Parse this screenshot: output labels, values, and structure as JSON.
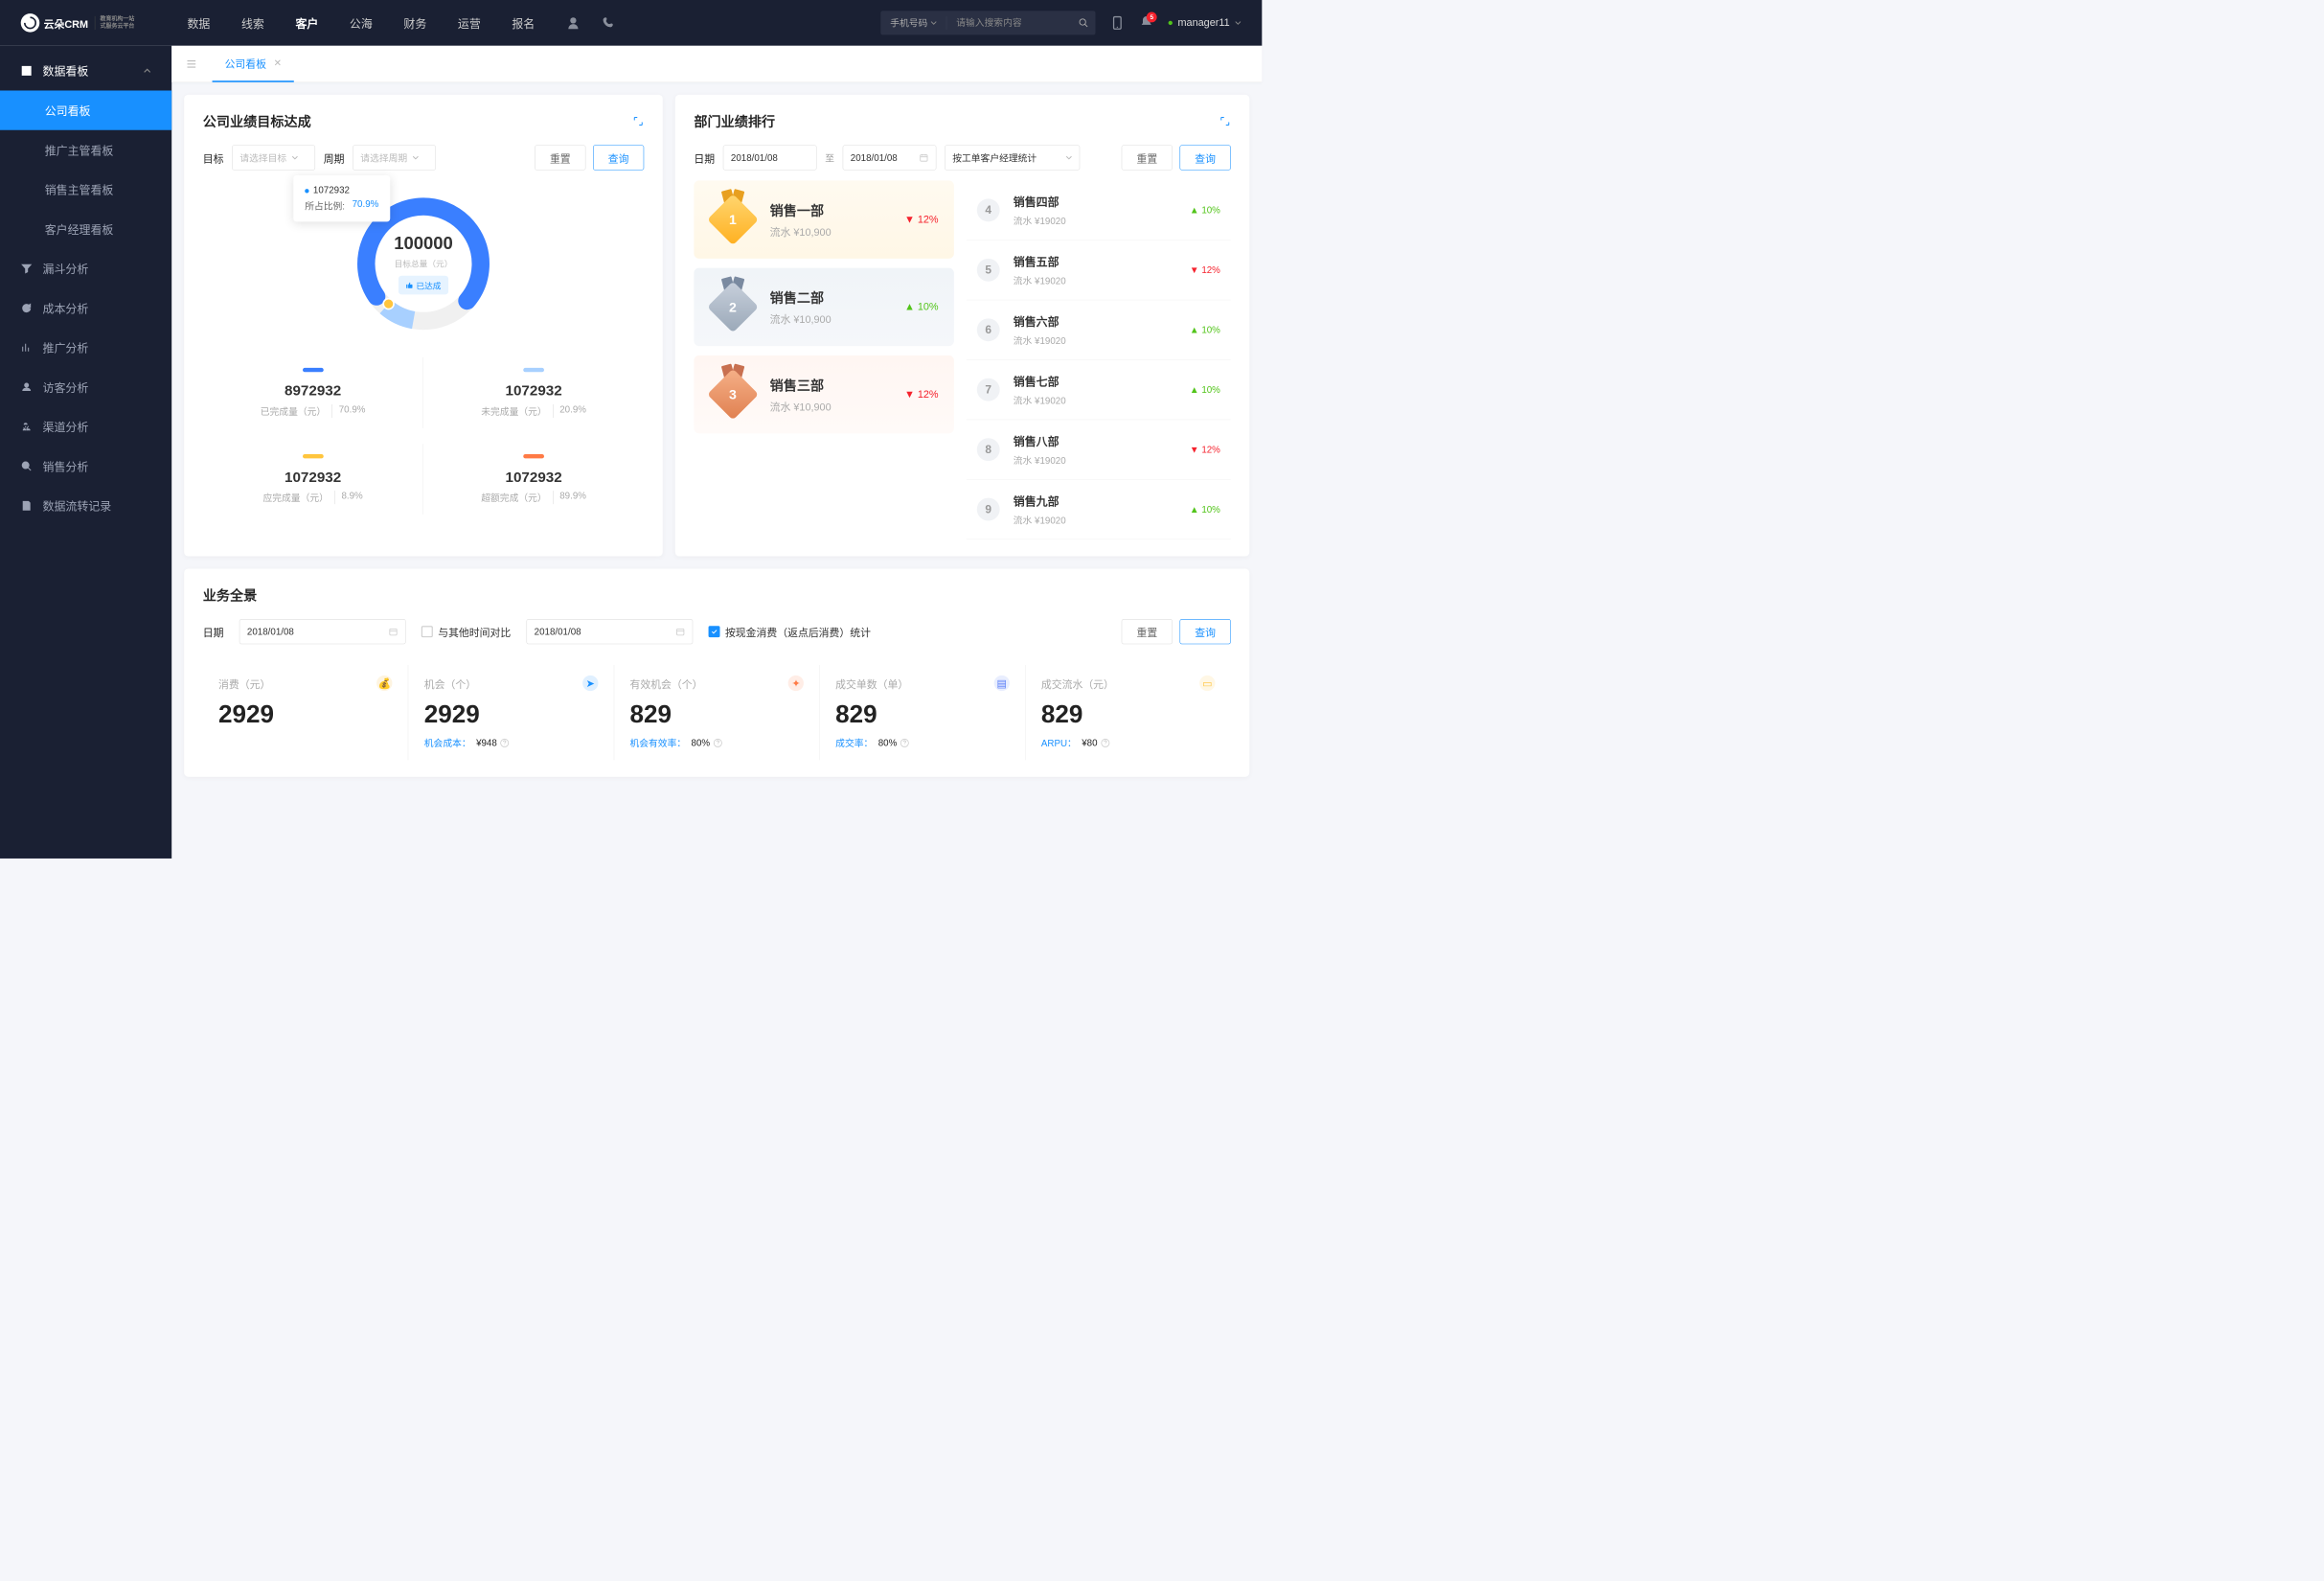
{
  "header": {
    "logo": "云朵CRM",
    "logoSub1": "教育机构一站",
    "logoSub2": "式服务云平台",
    "nav": [
      "数据",
      "线索",
      "客户",
      "公海",
      "财务",
      "运营",
      "报名"
    ],
    "navBold": 2,
    "searchSelect": "手机号码",
    "searchPlaceholder": "请输入搜索内容",
    "badge": "5",
    "user": "manager11"
  },
  "sidebar": {
    "groups": [
      {
        "label": "数据看板",
        "expanded": true,
        "icon": "dashboard",
        "subs": [
          {
            "label": "公司看板",
            "active": true
          },
          {
            "label": "推广主管看板"
          },
          {
            "label": "销售主管看板"
          },
          {
            "label": "客户经理看板"
          }
        ]
      },
      {
        "label": "漏斗分析",
        "icon": "funnel"
      },
      {
        "label": "成本分析",
        "icon": "refresh"
      },
      {
        "label": "推广分析",
        "icon": "chart"
      },
      {
        "label": "访客分析",
        "icon": "visitor"
      },
      {
        "label": "渠道分析",
        "icon": "channel"
      },
      {
        "label": "销售分析",
        "icon": "magnify"
      },
      {
        "label": "数据流转记录",
        "icon": "record"
      }
    ]
  },
  "tab": {
    "label": "公司看板"
  },
  "target": {
    "title": "公司业绩目标达成",
    "filters": {
      "targetLabel": "目标",
      "targetPlaceholder": "请选择目标",
      "periodLabel": "周期",
      "periodPlaceholder": "请选择周期",
      "reset": "重置",
      "query": "查询"
    },
    "donut": {
      "total": "100000",
      "totalLabel": "目标总量（元）",
      "status": "已达成"
    },
    "tooltip": {
      "value": "1072932",
      "label": "所占比例:",
      "pct": "70.9%"
    },
    "metrics": [
      {
        "bar": "#3a7fff",
        "value": "8972932",
        "label": "已完成量（元）",
        "pct": "70.9%"
      },
      {
        "bar": "#a8d0ff",
        "value": "1072932",
        "label": "未完成量（元）",
        "pct": "20.9%"
      },
      {
        "bar": "#ffc53d",
        "value": "1072932",
        "label": "应完成量（元）",
        "pct": "8.9%"
      },
      {
        "bar": "#ff7a45",
        "value": "1072932",
        "label": "超额完成（元）",
        "pct": "89.9%"
      }
    ]
  },
  "rank": {
    "title": "部门业绩排行",
    "filters": {
      "dateLabel": "日期",
      "dateFrom": "2018/01/08",
      "dateSep": "至",
      "dateTo": "2018/01/08",
      "groupBy": "按工单客户经理统计",
      "reset": "重置",
      "query": "查询"
    },
    "top3": [
      {
        "name": "销售一部",
        "sub": "流水 ¥10,900",
        "delta": "12%",
        "dir": "down"
      },
      {
        "name": "销售二部",
        "sub": "流水 ¥10,900",
        "delta": "10%",
        "dir": "up"
      },
      {
        "name": "销售三部",
        "sub": "流水 ¥10,900",
        "delta": "12%",
        "dir": "down"
      }
    ],
    "rest": [
      {
        "n": "4",
        "name": "销售四部",
        "sub": "流水 ¥19020",
        "delta": "10%",
        "dir": "up"
      },
      {
        "n": "5",
        "name": "销售五部",
        "sub": "流水 ¥19020",
        "delta": "12%",
        "dir": "down"
      },
      {
        "n": "6",
        "name": "销售六部",
        "sub": "流水 ¥19020",
        "delta": "10%",
        "dir": "up"
      },
      {
        "n": "7",
        "name": "销售七部",
        "sub": "流水 ¥19020",
        "delta": "10%",
        "dir": "up"
      },
      {
        "n": "8",
        "name": "销售八部",
        "sub": "流水 ¥19020",
        "delta": "12%",
        "dir": "down"
      },
      {
        "n": "9",
        "name": "销售九部",
        "sub": "流水 ¥19020",
        "delta": "10%",
        "dir": "up"
      }
    ]
  },
  "biz": {
    "title": "业务全景",
    "filters": {
      "dateLabel": "日期",
      "date1": "2018/01/08",
      "compareLabel": "与其他时间对比",
      "date2": "2018/01/08",
      "checkLabel": "按现金消费（返点后消费）统计",
      "reset": "重置",
      "query": "查询"
    },
    "kpis": [
      {
        "label": "消费（元）",
        "value": "2929",
        "badge": "#faad14",
        "sub": ""
      },
      {
        "label": "机会（个）",
        "value": "2929",
        "badge": "#1890ff",
        "subLabel": "机会成本：",
        "subVal": "¥948"
      },
      {
        "label": "有效机会（个）",
        "value": "829",
        "badge": "#ff7a45",
        "subLabel": "机会有效率：",
        "subVal": "80%"
      },
      {
        "label": "成交单数（单）",
        "value": "829",
        "badge": "#597ef7",
        "subLabel": "成交率：",
        "subVal": "80%"
      },
      {
        "label": "成交流水（元）",
        "value": "829",
        "badge": "#ffc53d",
        "subLabel": "ARPU：",
        "subVal": "¥80"
      }
    ]
  },
  "chart_data": {
    "type": "pie",
    "title": "公司业绩目标达成",
    "total": 100000,
    "series": [
      {
        "name": "已完成量",
        "value": 8972932,
        "pct": 70.9,
        "color": "#3a7fff"
      },
      {
        "name": "未完成量",
        "value": 1072932,
        "pct": 20.9,
        "color": "#a8d0ff"
      },
      {
        "name": "应完成量",
        "value": 1072932,
        "pct": 8.9,
        "color": "#ffc53d"
      },
      {
        "name": "超额完成",
        "value": 1072932,
        "pct": 89.9,
        "color": "#ff7a45"
      }
    ]
  }
}
